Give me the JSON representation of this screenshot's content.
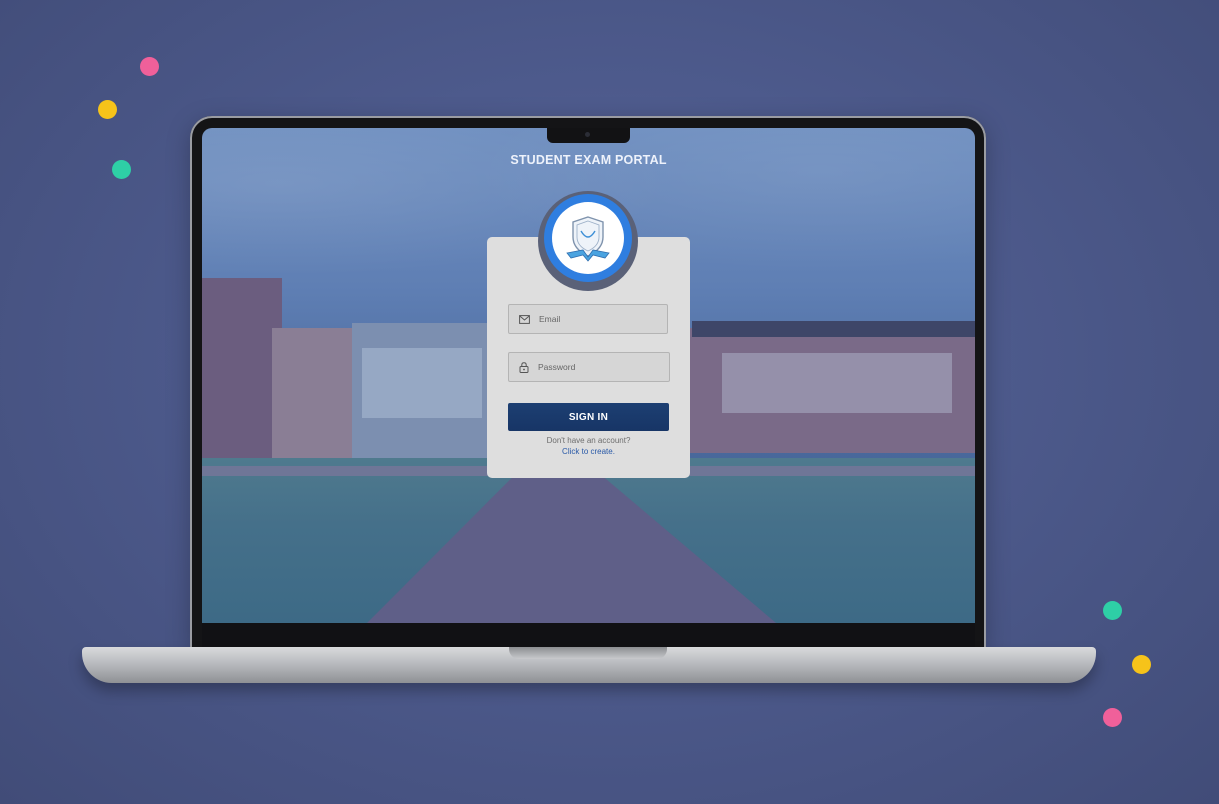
{
  "portal": {
    "title": "STUDENT EXAM PORTAL"
  },
  "login": {
    "email_placeholder": "Email",
    "password_placeholder": "Password",
    "submit_label": "SIGN IN",
    "no_account_text": "Don't have an account?",
    "create_link": "Click to create."
  },
  "icons": {
    "email": "mail-icon",
    "password": "lock-icon",
    "logo": "crest-logo"
  },
  "colors": {
    "background": "#4d5a8c",
    "button": "#1d3f72",
    "logo_ring": "#2f7ee0",
    "link": "#2a5aa8",
    "confetti": [
      "#f0609a",
      "#f6c31a",
      "#2ecfa6"
    ]
  }
}
